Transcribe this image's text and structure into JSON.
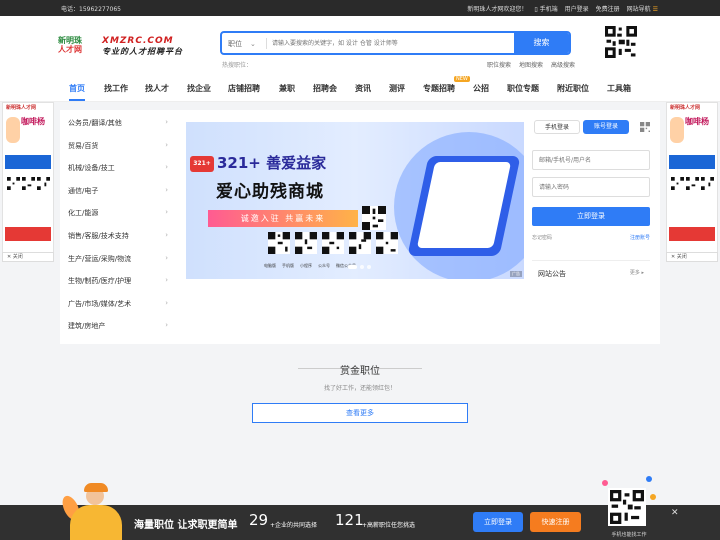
{
  "topbar": {
    "phone": "电话：15962277065",
    "welcome": "新明珠人才网欢迎您！",
    "mobile": "手机端",
    "login": "用户登录",
    "register": "免费注册",
    "site_nav": "网站导航"
  },
  "logo": {
    "mark_line1": "新明珠",
    "mark_line2": "人才网",
    "domain": "XMZRC.COM",
    "tagline": "专业的人才招聘平台"
  },
  "search": {
    "type": "职位",
    "placeholder": "请输入要搜索的关键字，如 设计 仓管 设计师等",
    "button": "搜索",
    "hot_label": "热搜职位：",
    "links": [
      "职位搜索",
      "地图搜索",
      "高级搜索"
    ]
  },
  "nav": {
    "items": [
      "首页",
      "找工作",
      "找人才",
      "找企业",
      "店铺招聘",
      "兼职",
      "招聘会",
      "资讯",
      "测评",
      "专题招聘",
      "公招",
      "职位专题",
      "附近职位",
      "工具箱"
    ],
    "new_badge": "NEW"
  },
  "categories": [
    "公务员/翻译/其他",
    "贸易/百货",
    "机械/设备/技工",
    "通信/电子",
    "化工/能源",
    "销售/客服/技术支持",
    "生产/营运/采购/物流",
    "生物/制药/医疗/护理",
    "广告/市场/媒体/艺术",
    "建筑/房地产"
  ],
  "banner": {
    "brand": "321+ 善爱益家",
    "title": "爱心助残商城",
    "slogan": "诚邀入驻 共赢未来",
    "logo_text": "321+",
    "qr_labels": [
      "电脑版",
      "手机版",
      "小程序",
      "公众号",
      "微信公众号"
    ],
    "ad_tag": "广告"
  },
  "login": {
    "tab_mobile": "手机登录",
    "tab_account": "账号登录",
    "account_placeholder": "邮箱/手机号/用户名",
    "password_placeholder": "请输入密码",
    "submit": "立即登录",
    "forgot": "忘记密码",
    "register": "注册账号"
  },
  "notice": {
    "title": "网站公告",
    "more": "更多"
  },
  "bounty": {
    "title": "赏金职位",
    "subtitle": "找了好工作，还能领红包！",
    "more": "查看更多"
  },
  "side_ad": {
    "title": "新明珠人才网",
    "big": "咖啡杨",
    "close": "关闭"
  },
  "bottombar": {
    "slogan": "海量职位 让求职更简单",
    "num1": "29",
    "text1": "+企业的共同选择",
    "num2": "121",
    "text2": "+高薪职位任您挑选",
    "login": "立即登录",
    "register": "快速注册",
    "qr_caption": "手机也能找工作"
  },
  "colors": {
    "primary": "#2f7cf6",
    "accent_orange": "#f57c1f",
    "topbar": "#2a2a2a"
  }
}
